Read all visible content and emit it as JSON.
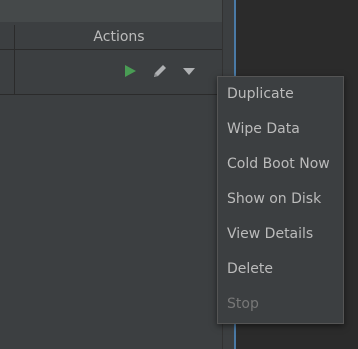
{
  "table": {
    "header": {
      "actions_label": "Actions"
    }
  },
  "row_actions": {
    "run_icon": "play-icon",
    "edit_icon": "pencil-icon",
    "more_icon": "dropdown-triangle-icon"
  },
  "menu": {
    "items": [
      {
        "label": "Duplicate",
        "enabled": true
      },
      {
        "label": "Wipe Data",
        "enabled": true
      },
      {
        "label": "Cold Boot Now",
        "enabled": true
      },
      {
        "label": "Show on Disk",
        "enabled": true
      },
      {
        "label": "View Details",
        "enabled": true
      },
      {
        "label": "Delete",
        "enabled": true
      },
      {
        "label": "Stop",
        "enabled": false
      }
    ]
  },
  "colors": {
    "background": "#2b2b2b",
    "panel": "#3c3f41",
    "text": "#bbbbbb",
    "disabled_text": "#777777",
    "play_green": "#499c54",
    "icon_gray": "#afb1b3",
    "focus_blue": "#4a7aa6"
  }
}
